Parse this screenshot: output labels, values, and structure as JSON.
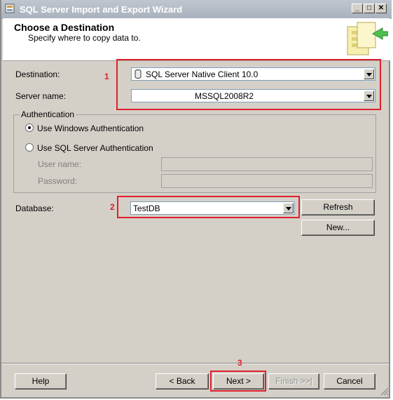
{
  "window": {
    "title": "SQL Server Import and Export Wizard"
  },
  "header": {
    "title": "Choose a Destination",
    "subtitle": "Specify where to copy data to."
  },
  "destination": {
    "label": "Destination:",
    "value": "SQL Server Native Client 10.0"
  },
  "server": {
    "label": "Server name:",
    "value": "MSSQL2008R2"
  },
  "authentication": {
    "title": "Authentication",
    "windows_label": "Use Windows Authentication",
    "sql_label": "Use SQL Server Authentication",
    "username_label": "User name:",
    "password_label": "Password:"
  },
  "database": {
    "label": "Database:",
    "value": "TestDB",
    "refresh_label": "Refresh",
    "new_label": "New..."
  },
  "callouts": [
    "1",
    "2",
    "3"
  ],
  "footer": {
    "help": "Help",
    "back": "< Back",
    "next": "Next >",
    "finish": "Finish >>|",
    "cancel": "Cancel"
  },
  "colors": {
    "highlight": "#e0202a",
    "face": "#d4d0c8"
  },
  "icons": [
    "database-icon",
    "wizard-graphic-icon",
    "app-icon",
    "minimize-icon",
    "maximize-icon",
    "close-icon",
    "size-grip-icon"
  ]
}
